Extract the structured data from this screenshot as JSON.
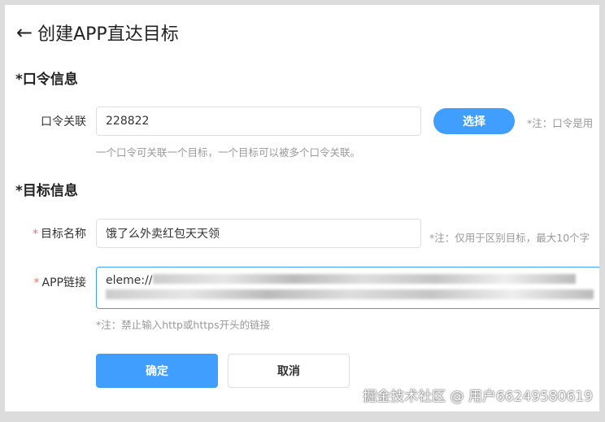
{
  "header": {
    "title": "创建APP直达目标"
  },
  "command_section": {
    "title": "*口令信息",
    "label": "口令关联",
    "value": "228822",
    "select_button": "选择",
    "note": "*注：口令是用",
    "help": "一个口令可关联一个目标，一个目标可以被多个口令关联。"
  },
  "target_section": {
    "title": "*目标信息",
    "name": {
      "required": "*",
      "label": "目标名称",
      "value": "饿了么外卖红包天天领",
      "note": "*注：仅用于区别目标，最大10个字"
    },
    "link": {
      "required": "*",
      "label": "APP链接",
      "value_prefix": "eleme://",
      "note": "*注：禁止输入http或https开头的链接"
    }
  },
  "actions": {
    "confirm": "确定",
    "cancel": "取消"
  },
  "watermark": "掘金技术社区 @ 用户66249580619",
  "colors": {
    "primary": "#409eff"
  }
}
